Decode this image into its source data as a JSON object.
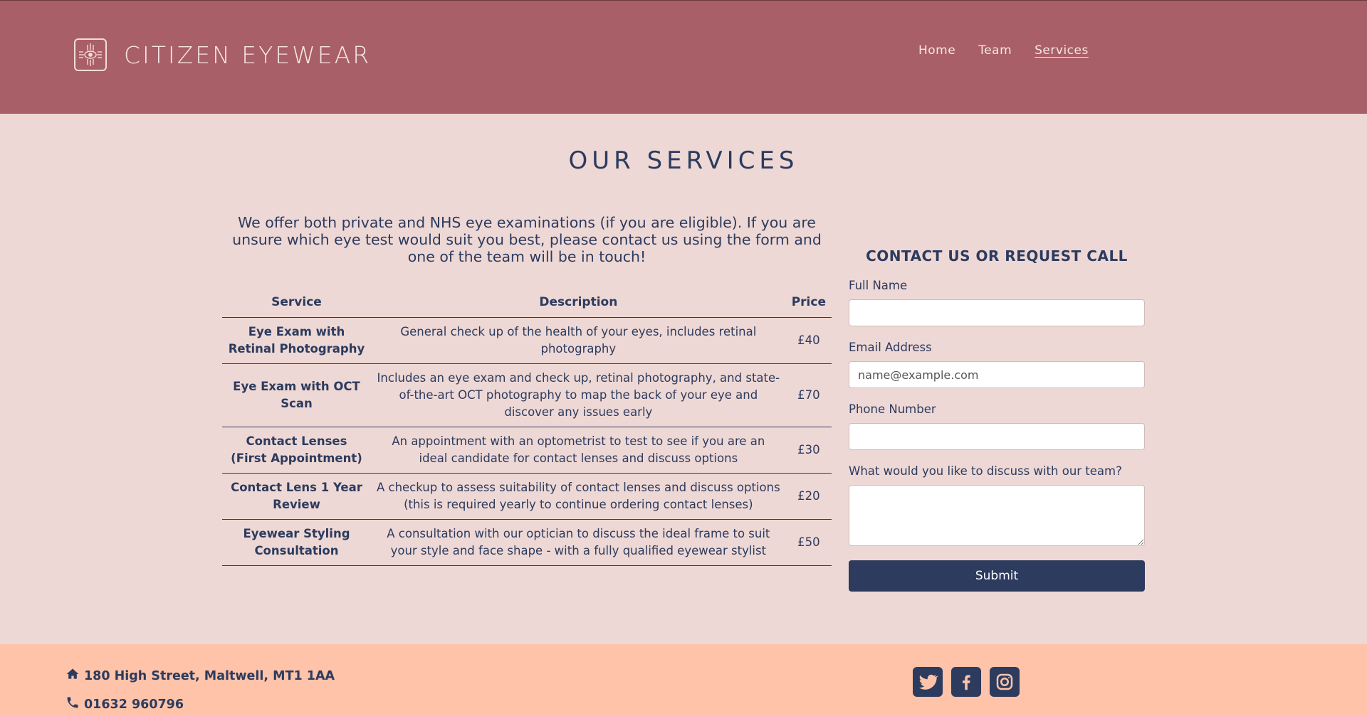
{
  "header": {
    "brand_name": "CITIZEN EYEWEAR",
    "nav": [
      {
        "label": "Home"
      },
      {
        "label": "Team"
      },
      {
        "label": "Services",
        "active": true
      }
    ]
  },
  "main": {
    "title": "OUR SERVICES",
    "intro": "We offer both private and NHS eye examinations (if you are eligible). If you are unsure which eye test would suit you best, please contact us using the form and one of the team will be in touch!",
    "table": {
      "headers": [
        "Service",
        "Description",
        "Price"
      ],
      "rows": [
        {
          "service": "Eye Exam with Retinal Photography",
          "description": "General check up of the health of your eyes, includes retinal photography",
          "price": "£40"
        },
        {
          "service": "Eye Exam with OCT Scan",
          "description": "Includes an eye exam and check up, retinal photography, and state-of-the-art OCT photography to map the back of your eye and discover any issues early",
          "price": "£70"
        },
        {
          "service": "Contact Lenses (First Appointment)",
          "description": "An appointment with an optometrist to test to see if you are an ideal candidate for contact lenses and discuss options",
          "price": "£30"
        },
        {
          "service": "Contact Lens 1 Year Review",
          "description": "A checkup to assess suitability of contact lenses and discuss options (this is required yearly to continue ordering contact lenses)",
          "price": "£20"
        },
        {
          "service": "Eyewear Styling Consultation",
          "description": "A consultation with our optician to discuss the ideal frame to suit your style and face shape - with a fully qualified eyewear stylist",
          "price": "£50"
        }
      ]
    }
  },
  "contact": {
    "title": "CONTACT US OR REQUEST CALL",
    "full_name_label": "Full Name",
    "full_name_value": "",
    "email_label": "Email Address",
    "email_placeholder": "name@example.com",
    "phone_label": "Phone Number",
    "phone_value": "",
    "message_label": "What would you like to discuss with our team?",
    "message_value": "",
    "submit_label": "Submit"
  },
  "footer": {
    "address": "180 High Street, Maltwell, MT1 1AA",
    "phone": "01632 960796",
    "address_icon": "home-icon",
    "phone_icon": "phone-icon",
    "socials": [
      {
        "icon": "twitter-icon"
      },
      {
        "icon": "facebook-icon"
      },
      {
        "icon": "instagram-icon"
      }
    ]
  },
  "colors": {
    "header_bg": "#a95f67",
    "page_bg": "#eed8d5",
    "footer_bg": "#fec3a9",
    "primary": "#2c3b5e"
  }
}
